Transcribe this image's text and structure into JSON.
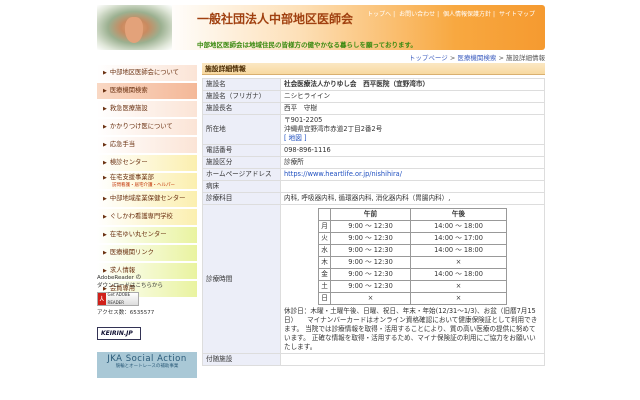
{
  "header": {
    "title": "一般社団法人中部地区医師会",
    "tagline": "中部地区医師会は地域住民の皆様方の健やかなる暮らしを願っております。",
    "top_links": [
      "トップへ",
      "お問い合わせ",
      "個人情報保護方針",
      "サイトマップ"
    ]
  },
  "breadcrumb": {
    "home": "トップページ",
    "search": "医療機関検索",
    "current": "施設詳細情報",
    "sep": ">"
  },
  "sidebar": {
    "items": [
      {
        "label": "中部地区医師会について"
      },
      {
        "label": "医療機関検索"
      },
      {
        "label": "救急医療施設"
      },
      {
        "label": "かかりつけ医について"
      },
      {
        "label": "応急手当"
      },
      {
        "label": "検診センター"
      },
      {
        "label": "在宅支援事業部",
        "sub": "訪問看護・居宅介護・ヘルパー"
      },
      {
        "label": "中部地域産業保健センター"
      },
      {
        "label": "ぐしかわ看護専門学校"
      },
      {
        "label": "在宅ゆい丸センター"
      },
      {
        "label": "医療機関リンク"
      },
      {
        "label": "求人情報"
      },
      {
        "label": "会員専用"
      }
    ],
    "adobe_text1": "AdobeReader の",
    "adobe_text2": "ダウンロードはこちらから",
    "adobe_badge": "Get ADOBE READER",
    "access_count": "アクセス数：6535577",
    "keirin": "KEIRIN.JP",
    "jka_title": "JKA Social Action",
    "jka_sub": "競輪とオートレースの補助事業"
  },
  "main": {
    "section_title": "施設詳細情報",
    "rows": {
      "name_label": "施設名",
      "name": "社会医療法人かりゆし会　西平医院（宜野湾市）",
      "kana_label": "施設名（フリガナ）",
      "kana": "ニシヒライイン",
      "head_label": "施設長名",
      "head": "西平　守樹",
      "addr_label": "所在地",
      "postal": "〒901-2205",
      "address": "沖縄県宜野湾市赤道2丁目2番2号",
      "map_link": "[ 地図 ]",
      "tel_label": "電話番号",
      "tel": "098-896-1116",
      "type_label": "施設区分",
      "type": "診療所",
      "url_label": "ホームページアドレス",
      "url": "https://www.heartlife.or.jp/nishihira/",
      "beds_label": "病床",
      "dept_label": "診療科目",
      "dept": "内科, 呼吸器内科, 循環器内科, 消化器内科（胃腸内科）,",
      "hours_label": "診療時間",
      "note": "休診日：木曜・土曜午後、日曜、祝日、年末・年始(12/31〜1/3)、お盆（旧暦7月15日）　　マイナンバーカードはオンライン資格確認において健康保険証として利用できます。 当院では診療情報を取得・活用することにより、質の高い医療の提供に努めています。 正確な情報を取得・活用するため、マイナ保険証の利用にご協力をお願いいたします。",
      "facility_label": "付随施設"
    },
    "hours": {
      "am_header": "午前",
      "pm_header": "午後",
      "days": [
        {
          "day": "月",
          "am": "9:00 〜 12:30",
          "pm": "14:00 〜 18:00"
        },
        {
          "day": "火",
          "am": "9:00 〜 12:30",
          "pm": "14:00 〜 17:00"
        },
        {
          "day": "水",
          "am": "9:00 〜 12:30",
          "pm": "14:00 〜 18:00"
        },
        {
          "day": "木",
          "am": "9:00 〜 12:30",
          "pm": "×"
        },
        {
          "day": "金",
          "am": "9:00 〜 12:30",
          "pm": "14:00 〜 18:00"
        },
        {
          "day": "土",
          "am": "9:00 〜 12:30",
          "pm": "×"
        },
        {
          "day": "日",
          "am": "×",
          "pm": "×"
        }
      ]
    }
  }
}
